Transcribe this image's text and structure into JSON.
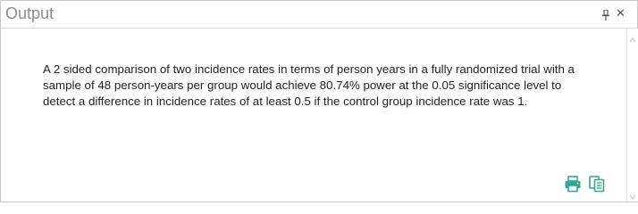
{
  "panel": {
    "title": "Output",
    "pin_icon": "pin-icon",
    "close_icon": "close-icon",
    "close_glyph": "✕"
  },
  "output": {
    "text": "A 2 sided comparison of two incidence rates in terms of person years in a fully randomized trial with a sample of 48 person-years per group would achieve 80.74% power at the 0.05 significance level to detect a difference in incidence rates of at least 0.5 if the control group incidence rate was 1."
  },
  "toolbar": {
    "print_icon": "print-icon",
    "copy_icon": "copy-icon"
  },
  "colors": {
    "icon_accent": "#2fa88e",
    "title_text": "#8c8c8c",
    "body_text": "#222222"
  }
}
